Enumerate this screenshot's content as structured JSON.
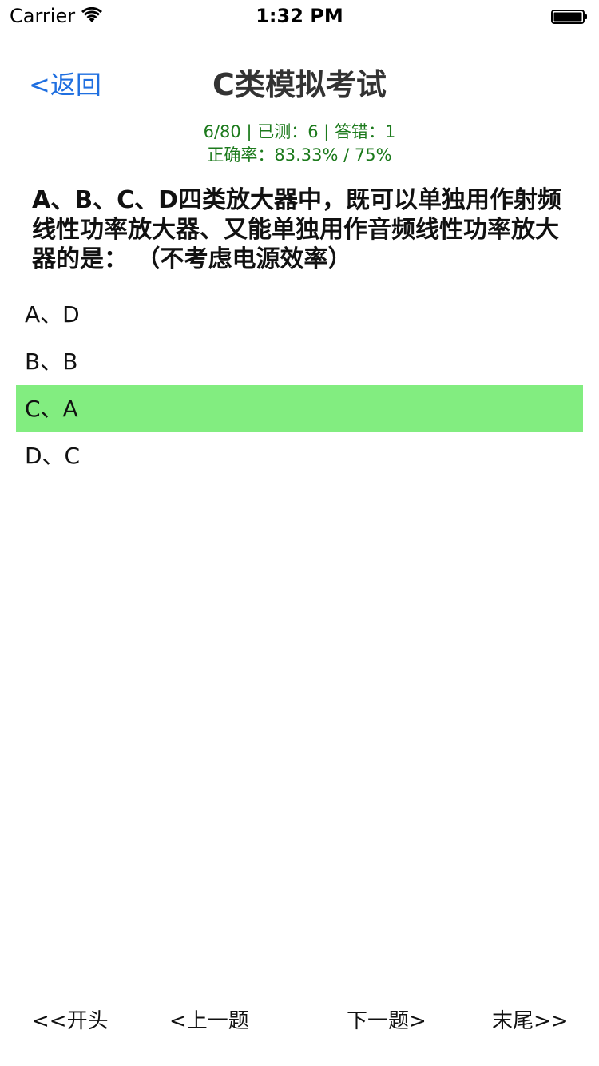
{
  "status_bar": {
    "carrier": "Carrier",
    "time": "1:32 PM"
  },
  "nav": {
    "back_label": "<返回",
    "title": "C类模拟考试"
  },
  "stats": {
    "line1": "6/80 | 已测：6 | 答错：1",
    "line2": "正确率：83.33% / 75%"
  },
  "question": {
    "text": "A、B、C、D四类放大器中，既可以单独用作射频线性功率放大器、又能单独用作音频线性功率放大器的是：  （不考虑电源效率）"
  },
  "options": [
    {
      "label": "A、D",
      "selected": false
    },
    {
      "label": "B、B",
      "selected": false
    },
    {
      "label": "C、A",
      "selected": true
    },
    {
      "label": "D、C",
      "selected": false
    }
  ],
  "bottom_nav": {
    "first": "<<开头",
    "prev": "<上一题",
    "next": "下一题>",
    "last": "末尾>>"
  },
  "colors": {
    "link_blue": "#1f6fe0",
    "stats_green": "#1c7a1c",
    "selected_bg": "#82ed80"
  }
}
